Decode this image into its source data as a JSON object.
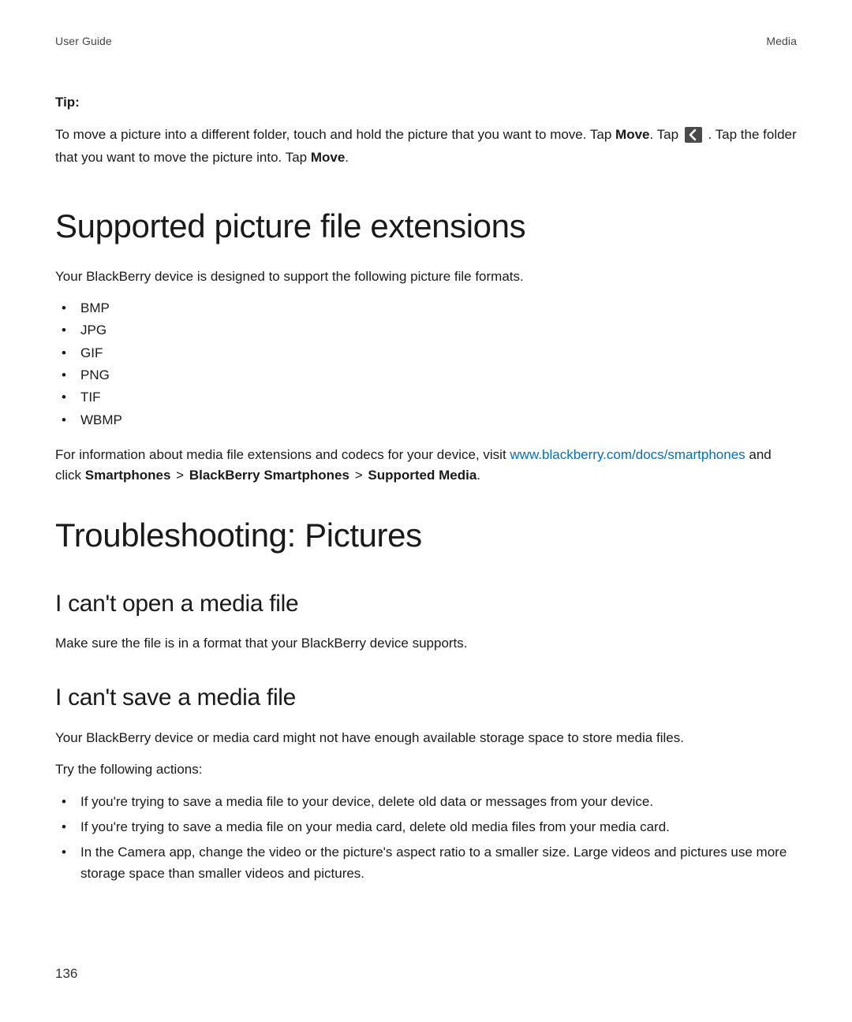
{
  "header": {
    "left": "User Guide",
    "right": "Media"
  },
  "tip": {
    "label": "Tip:",
    "part1": "To move a picture into a different folder, touch and hold the picture that you want to move. Tap ",
    "move1": "Move",
    "part2": ". Tap ",
    "icon_name": "back-icon",
    "part3": " . Tap the folder that you want to move the picture into. Tap ",
    "move2": "Move",
    "part4": "."
  },
  "section1": {
    "heading": "Supported picture file extensions",
    "intro": "Your BlackBerry device is designed to support the following picture file formats.",
    "formats": [
      "BMP",
      "JPG",
      "GIF",
      "PNG",
      "TIF",
      "WBMP"
    ],
    "info_pre": "For information about media file extensions and codecs for your device, visit ",
    "link_text": "www.blackberry.com/docs/smartphones",
    "info_mid": " and click ",
    "bc1": "Smartphones",
    "sep": ">",
    "bc2": "BlackBerry Smartphones",
    "bc3": "Supported Media",
    "info_end": "."
  },
  "section2": {
    "heading": "Troubleshooting: Pictures",
    "sub1": {
      "heading": "I can't open a media file",
      "body": "Make sure the file is in a format that your BlackBerry device supports."
    },
    "sub2": {
      "heading": "I can't save a media file",
      "body1": "Your BlackBerry device or media card might not have enough available storage space to store media files.",
      "body2": "Try the following actions:",
      "actions": [
        "If you're trying to save a media file to your device, delete old data or messages from your device.",
        "If you're trying to save a media file on your media card, delete old media files from your media card.",
        "In the Camera app, change the video or the picture's aspect ratio to a smaller size. Large videos and pictures use more storage space than smaller videos and pictures."
      ]
    }
  },
  "page_number": "136"
}
